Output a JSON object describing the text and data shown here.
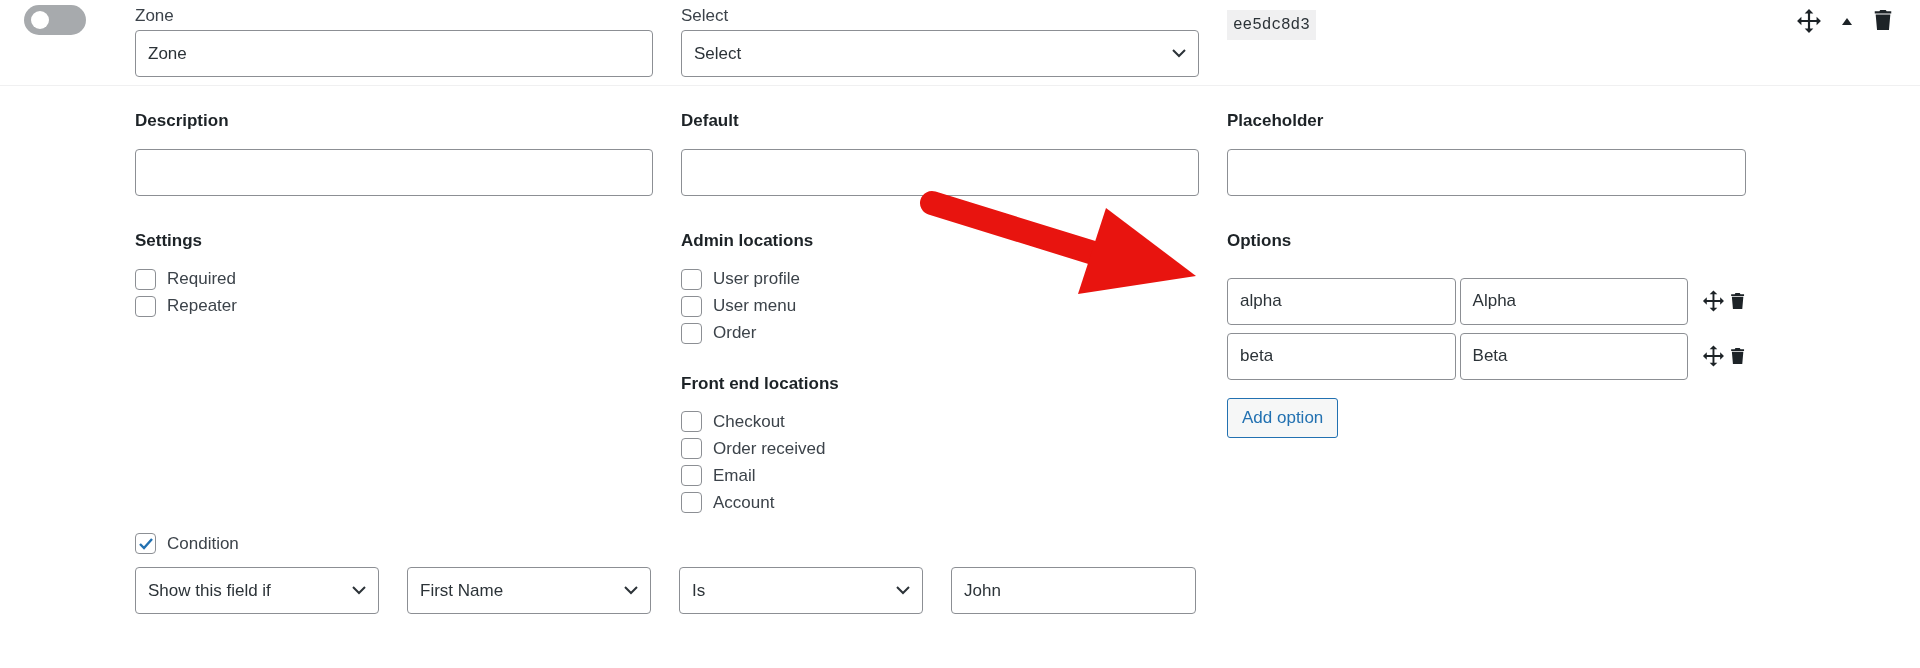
{
  "header": {
    "toggle": {
      "on": false
    },
    "label_field": {
      "label": "Zone",
      "value": "Zone"
    },
    "type_field": {
      "label": "Select",
      "value": "Select"
    },
    "field_id": "ee5dc8d3"
  },
  "text_fields": [
    {
      "label": "Description"
    },
    {
      "label": "Default"
    },
    {
      "label": "Placeholder"
    }
  ],
  "settings": {
    "title": "Settings",
    "items": [
      {
        "label": "Required",
        "checked": false
      },
      {
        "label": "Repeater",
        "checked": false
      }
    ]
  },
  "admin_locations": {
    "title": "Admin locations",
    "items": [
      {
        "label": "User profile",
        "checked": false
      },
      {
        "label": "User menu",
        "checked": false
      },
      {
        "label": "Order",
        "checked": false
      }
    ]
  },
  "front_end_locations": {
    "title": "Front end locations",
    "items": [
      {
        "label": "Checkout",
        "checked": false
      },
      {
        "label": "Order received",
        "checked": false
      },
      {
        "label": "Email",
        "checked": false
      },
      {
        "label": "Account",
        "checked": false
      }
    ]
  },
  "options": {
    "title": "Options",
    "rows": [
      {
        "value": "alpha",
        "label": "Alpha"
      },
      {
        "value": "beta",
        "label": "Beta"
      }
    ],
    "add_button": "Add option"
  },
  "condition": {
    "label": "Condition",
    "checked": true,
    "mode": "Show this field if",
    "field": "First Name",
    "operator": "Is",
    "value": "John"
  }
}
